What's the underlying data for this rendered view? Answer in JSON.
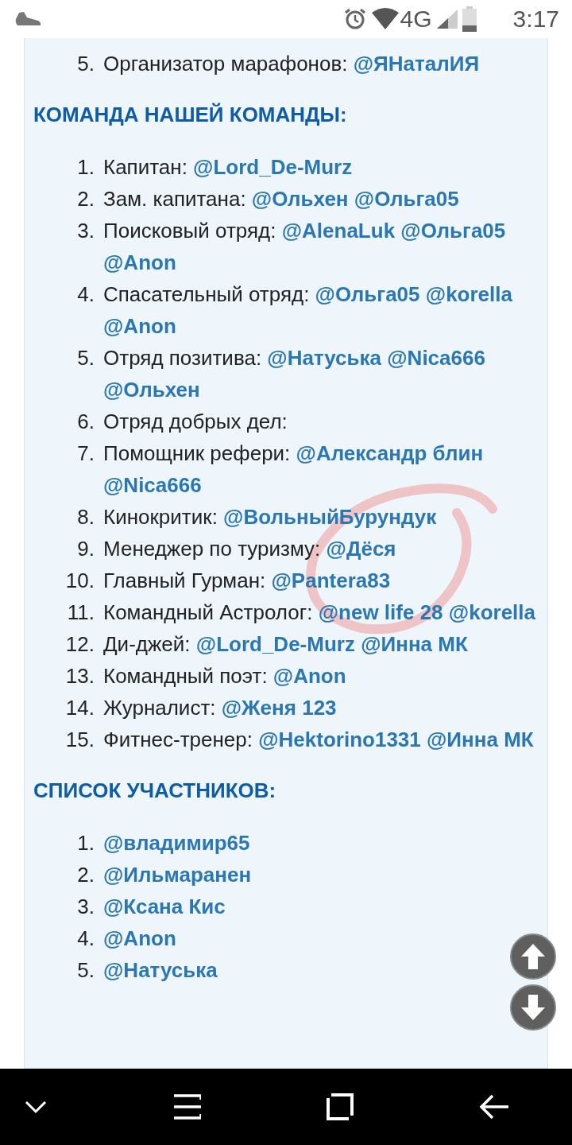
{
  "status_bar": {
    "time": "3:17",
    "network": "4G"
  },
  "top_list": [
    {
      "number": "5.",
      "label": "Организатор марафонов:",
      "mentions": [
        "@ЯНаталИЯ"
      ]
    }
  ],
  "sections": [
    {
      "heading": "КОМАНДА НАШЕЙ КОМАНДЫ:",
      "items": [
        {
          "number": "1.",
          "label": "Капитан:",
          "mentions": [
            "@Lord_De-Murz"
          ]
        },
        {
          "number": "2.",
          "label": "Зам. капитана:",
          "mentions": [
            "@Ольхен",
            "@Ольга05"
          ]
        },
        {
          "number": "3.",
          "label": "Поисковый отряд:",
          "mentions": [
            "@AlenaLuk",
            "@Ольга05",
            "@Anon"
          ]
        },
        {
          "number": "4.",
          "label": "Спасательный отряд:",
          "mentions": [
            "@Ольга05",
            "@korella",
            "@Anon"
          ]
        },
        {
          "number": "5.",
          "label": "Отряд позитива:",
          "mentions": [
            "@Натуська",
            "@Nica666",
            "@Ольхен"
          ]
        },
        {
          "number": "6.",
          "label": "Отряд добрых дел:"
        },
        {
          "number": "7.",
          "label": "Помощник рефери:",
          "mentions": [
            "@Александр блин",
            "@Nica666"
          ]
        },
        {
          "number": "8.",
          "label": "Кинокритик:",
          "mentions": [
            "@ВольныйБурундук"
          ]
        },
        {
          "number": "9.",
          "label": "Менеджер по туризму:",
          "mentions": [
            "@Дёся"
          ]
        },
        {
          "number": "10.",
          "label": "Главный Гурман:",
          "mentions": [
            "@Pantera83"
          ]
        },
        {
          "number": "11.",
          "label": "Командный Астролог:",
          "mentions": [
            "@new life 28",
            "@korella"
          ]
        },
        {
          "number": "12.",
          "label": "Ди-джей:",
          "mentions": [
            "@Lord_De-Murz",
            "@Инна МК"
          ]
        },
        {
          "number": "13.",
          "label": "Командный поэт:",
          "mentions": [
            "@Anon"
          ]
        },
        {
          "number": "14.",
          "label": "Журналист:",
          "mentions": [
            "@Женя 123"
          ]
        },
        {
          "number": "15.",
          "label": "Фитнес-тренер:",
          "mentions": [
            "@Hektorino1331",
            "@Инна МК"
          ]
        }
      ]
    },
    {
      "heading": "СПИСОК УЧАСТНИКОВ:",
      "items": [
        {
          "number": "1.",
          "mentions": [
            "@владимир65"
          ]
        },
        {
          "number": "2.",
          "mentions": [
            "@Ильмаранен"
          ]
        },
        {
          "number": "3.",
          "mentions": [
            "@Ксана Кис"
          ]
        },
        {
          "number": "4.",
          "mentions": [
            "@Anon"
          ]
        },
        {
          "number": "5.",
          "mentions": [
            "@Натуська"
          ]
        }
      ]
    }
  ]
}
